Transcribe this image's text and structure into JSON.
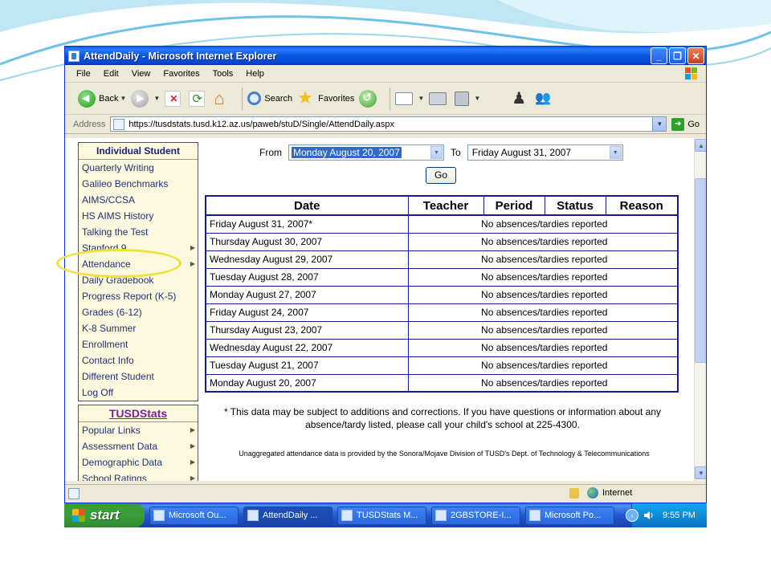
{
  "window": {
    "title": "AttendDaily - Microsoft Internet Explorer",
    "minimize": "_",
    "maximize": "❐",
    "close": "✕"
  },
  "menu": [
    "File",
    "Edit",
    "View",
    "Favorites",
    "Tools",
    "Help"
  ],
  "toolbar": {
    "back": "Back",
    "search": "Search",
    "favorites": "Favorites"
  },
  "address": {
    "label": "Address",
    "url": "https://tusdstats.tusd.k12.az.us/paweb/stuD/Single/AttendDaily.aspx",
    "go": "Go"
  },
  "nav": {
    "header": "Individual Student",
    "items": [
      {
        "label": "Quarterly Writing",
        "arrow": ""
      },
      {
        "label": "Galileo Benchmarks",
        "arrow": ""
      },
      {
        "label": "AIMS/CCSA",
        "arrow": ""
      },
      {
        "label": "HS AIMS History",
        "arrow": ""
      },
      {
        "label": "Talking the Test",
        "arrow": ""
      },
      {
        "label": "Stanford 9",
        "arrow": "▶"
      },
      {
        "label": "Attendance",
        "arrow": "▶"
      },
      {
        "label": "Daily Gradebook",
        "arrow": ""
      },
      {
        "label": "Progress Report (K-5)",
        "arrow": ""
      },
      {
        "label": "Grades (6-12)",
        "arrow": ""
      },
      {
        "label": "K-8 Summer",
        "arrow": ""
      },
      {
        "label": "Enrollment",
        "arrow": ""
      },
      {
        "label": "Contact Info",
        "arrow": ""
      },
      {
        "label": "Different Student",
        "arrow": ""
      },
      {
        "label": "Log Off",
        "arrow": ""
      }
    ],
    "header2": "TUSDStats",
    "items2": [
      {
        "label": "Popular Links",
        "arrow": "▶"
      },
      {
        "label": "Assessment Data",
        "arrow": "▶"
      },
      {
        "label": "Demographic Data",
        "arrow": "▶"
      },
      {
        "label": "School Ratings",
        "arrow": "▶"
      }
    ]
  },
  "filter": {
    "from_label": "From",
    "from_value": "Monday August 20, 2007",
    "to_label": "To",
    "to_value": "Friday August 31, 2007",
    "go_label": "Go"
  },
  "table": {
    "headers": [
      "Date",
      "Teacher",
      "Period",
      "Status",
      "Reason"
    ],
    "rows": [
      {
        "date": "Friday August 31, 2007*",
        "msg": "No absences/tardies reported"
      },
      {
        "date": "Thursday August 30, 2007",
        "msg": "No absences/tardies reported"
      },
      {
        "date": "Wednesday August 29, 2007",
        "msg": "No absences/tardies reported"
      },
      {
        "date": "Tuesday August 28, 2007",
        "msg": "No absences/tardies reported"
      },
      {
        "date": "Monday August 27, 2007",
        "msg": "No absences/tardies reported"
      },
      {
        "date": "Friday August 24, 2007",
        "msg": "No absences/tardies reported"
      },
      {
        "date": "Thursday August 23, 2007",
        "msg": "No absences/tardies reported"
      },
      {
        "date": "Wednesday August 22, 2007",
        "msg": "No absences/tardies reported"
      },
      {
        "date": "Tuesday August 21, 2007",
        "msg": "No absences/tardies reported"
      },
      {
        "date": "Monday August 20, 2007",
        "msg": "No absences/tardies reported"
      }
    ]
  },
  "note": "* This data may be subject to additions and corrections. If you have questions or information about any absence/tardy listed, please call your child's school at 225-4300.",
  "footer_note": "Unaggregated attendance data is provided by the Sonora/Mojave Division of TUSD's Dept. of Technology & Telecommunications",
  "status": {
    "zone": "Internet"
  },
  "taskbar": {
    "start": "start",
    "tasks": [
      {
        "label": "Microsoft Ou...",
        "active": false
      },
      {
        "label": "AttendDaily ...",
        "active": true
      },
      {
        "label": "TUSDStats M...",
        "active": false
      },
      {
        "label": "2GBSTORE-I...",
        "active": false
      },
      {
        "label": "Microsoft Po...",
        "active": false
      }
    ],
    "clock": "9:55 PM"
  },
  "colors": {
    "titlebar": "#0656e4",
    "nav_bg": "#fbf8de",
    "highlight_oval": "#f0e23c",
    "table_border": "#1a1a8a"
  }
}
